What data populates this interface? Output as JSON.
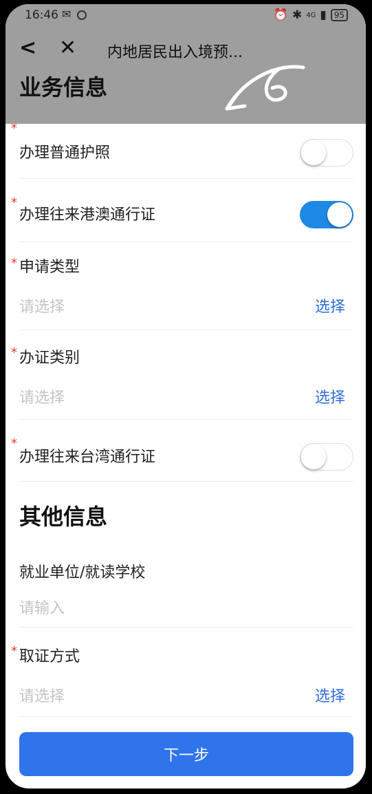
{
  "status": {
    "time": "16:46",
    "battery": "95",
    "net": "4G"
  },
  "nav": {
    "title": "内地居民出入境预..."
  },
  "section_business": {
    "title": "业务信息"
  },
  "items": {
    "passport": {
      "label": "办理普通护照",
      "on": false
    },
    "hk_macau": {
      "label": "办理往来港澳通行证",
      "on": true
    },
    "apply_type": {
      "label": "申请类型",
      "placeholder": "请选择",
      "action": "选择"
    },
    "cert_category": {
      "label": "办证类别",
      "placeholder": "请选择",
      "action": "选择"
    },
    "taiwan": {
      "label": "办理往来台湾通行证",
      "on": false
    }
  },
  "section_other": {
    "title": "其他信息"
  },
  "other": {
    "employer": {
      "label": "就业单位/就读学校",
      "placeholder": "请输入"
    },
    "pickup": {
      "label": "取证方式",
      "placeholder": "请选择",
      "action": "选择"
    }
  },
  "footer": {
    "next_label": "下一步"
  },
  "colors": {
    "accent": "#2f74ea",
    "toggle_on": "#1e88e5",
    "required": "#e53935"
  }
}
